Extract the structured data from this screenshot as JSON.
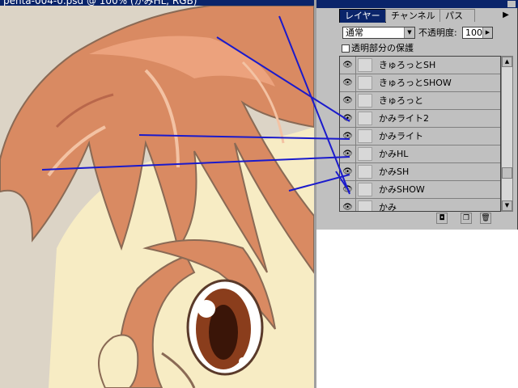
{
  "document": {
    "title": "penta-004-0.psd @ 100% (かみHL, RGB)",
    "illustration": "anime-character-hair-closeup"
  },
  "palette": {
    "tabs": [
      "レイヤー",
      "チャンネル",
      "パス"
    ],
    "active_tab": "レイヤー",
    "menu_icon": "triangle-right-icon",
    "blend_mode": "通常",
    "opacity_label": "不透明度:",
    "opacity_value": "100",
    "opacity_unit": "%",
    "preserve_transparency_label": "透明部分の保護",
    "layers": [
      {
        "name": "きゅろっとSH",
        "visible": true
      },
      {
        "name": "きゅろっとSHOW",
        "visible": true
      },
      {
        "name": "きゅろっと",
        "visible": true
      },
      {
        "name": "かみライト2",
        "visible": true
      },
      {
        "name": "かみライト",
        "visible": true
      },
      {
        "name": "かみHL",
        "visible": true
      },
      {
        "name": "かみSH",
        "visible": true
      },
      {
        "name": "かみSHOW",
        "visible": true
      },
      {
        "name": "かみ",
        "visible": true
      }
    ],
    "footer_buttons": [
      "new-mask-icon",
      "new-layer-icon",
      "trash-icon"
    ]
  },
  "annotations": {
    "line_color": "#1a1acc",
    "count": 6
  },
  "colors": {
    "palette_bg": "#c0c0c0",
    "titlebar": "#0a246a",
    "hair": "#d98a62",
    "skin": "#f7ecc4"
  }
}
